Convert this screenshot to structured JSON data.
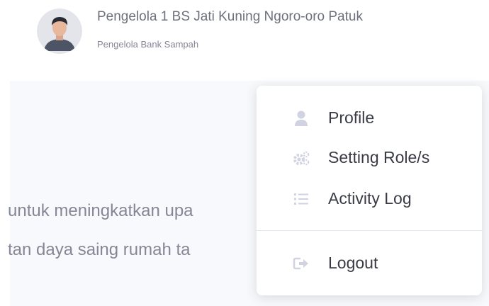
{
  "header": {
    "user_name": "Pengelola 1 BS Jati Kuning Ngoro-oro Patuk",
    "user_role": "Pengelola Bank Sampah"
  },
  "content": {
    "line1": "untuk meningkatkan upa",
    "line2": "tan daya saing rumah ta"
  },
  "dropdown": {
    "items": [
      {
        "label": "Profile",
        "icon": "user-icon"
      },
      {
        "label": "Setting Role/s",
        "icon": "cogs-icon"
      },
      {
        "label": "Activity Log",
        "icon": "list-icon"
      }
    ],
    "logout": {
      "label": "Logout",
      "icon": "sign-out-icon"
    }
  },
  "colors": {
    "text_muted": "#858796",
    "text_dark": "#3a3b45",
    "icon_gray": "#d1d3e2",
    "content_bg": "#f8f9fc"
  }
}
